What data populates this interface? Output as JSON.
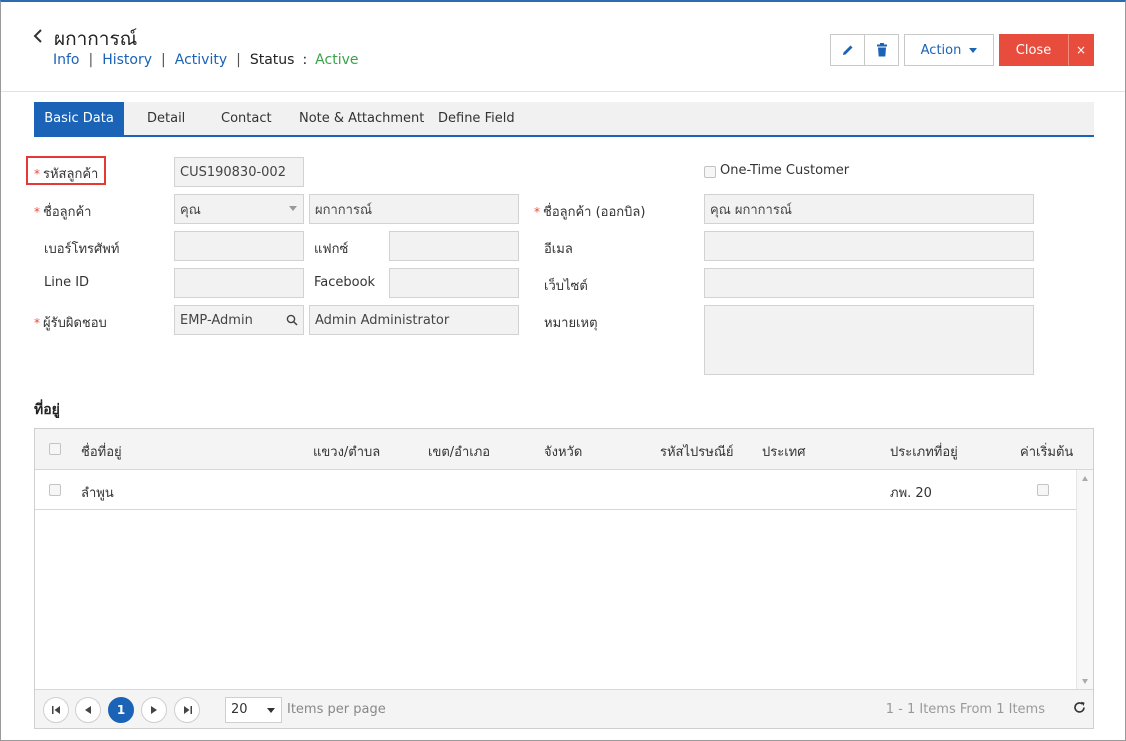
{
  "header": {
    "title": "ผกาการณ์",
    "nav": {
      "info": "Info",
      "history": "History",
      "activity": "Activity",
      "status_label": "Status",
      "colon": ":",
      "status_value": "Active",
      "sep": "|"
    },
    "action_label": "Action",
    "close_label": "Close",
    "close_x": "×"
  },
  "tabs": [
    "Basic Data",
    "Detail",
    "Contact",
    "Note & Attachment",
    "Define Field"
  ],
  "form": {
    "req_mark": "*",
    "customer_code_label": "รหัสลูกค้า",
    "customer_code_value": "CUS190830-002",
    "one_time_label": "One-Time Customer",
    "customer_name_label": "ชื่อลูกค้า",
    "title_prefix_value": "คุณ",
    "customer_name_value": "ผกาการณ์",
    "bill_name_label": "ชื่อลูกค้า (ออกบิล)",
    "bill_name_value": "คุณ ผกาการณ์",
    "phone_label": "เบอร์โทรศัพท์",
    "fax_label": "แฟกซ์",
    "email_label": "อีเมล",
    "line_label": "Line ID",
    "facebook_label": "Facebook",
    "website_label": "เว็บไซต์",
    "owner_label": "ผู้รับผิดชอบ",
    "owner_code_value": "EMP-Admin",
    "owner_name_value": "Admin Administrator",
    "note_label": "หมายเหตุ"
  },
  "address": {
    "section_title": "ที่อยู่",
    "columns": [
      "ชื่อที่อยู่",
      "แขวง/ตำบล",
      "เขต/อำเภอ",
      "จังหวัด",
      "รหัสไปรษณีย์",
      "ประเทศ",
      "ประเภทที่อยู่",
      "ค่าเริ่มต้น"
    ],
    "rows": [
      {
        "name": "ลำพูน",
        "type": "ภพ. 20"
      }
    ],
    "pager": {
      "current_page": "1",
      "page_size": "20",
      "items_per_page": "Items per page",
      "info": "1 - 1 Items From 1 Items"
    }
  },
  "colors": {
    "accent": "#1a63b6",
    "close": "#e74c3c",
    "active": "#3aa34a",
    "required": "#e74c3c"
  }
}
